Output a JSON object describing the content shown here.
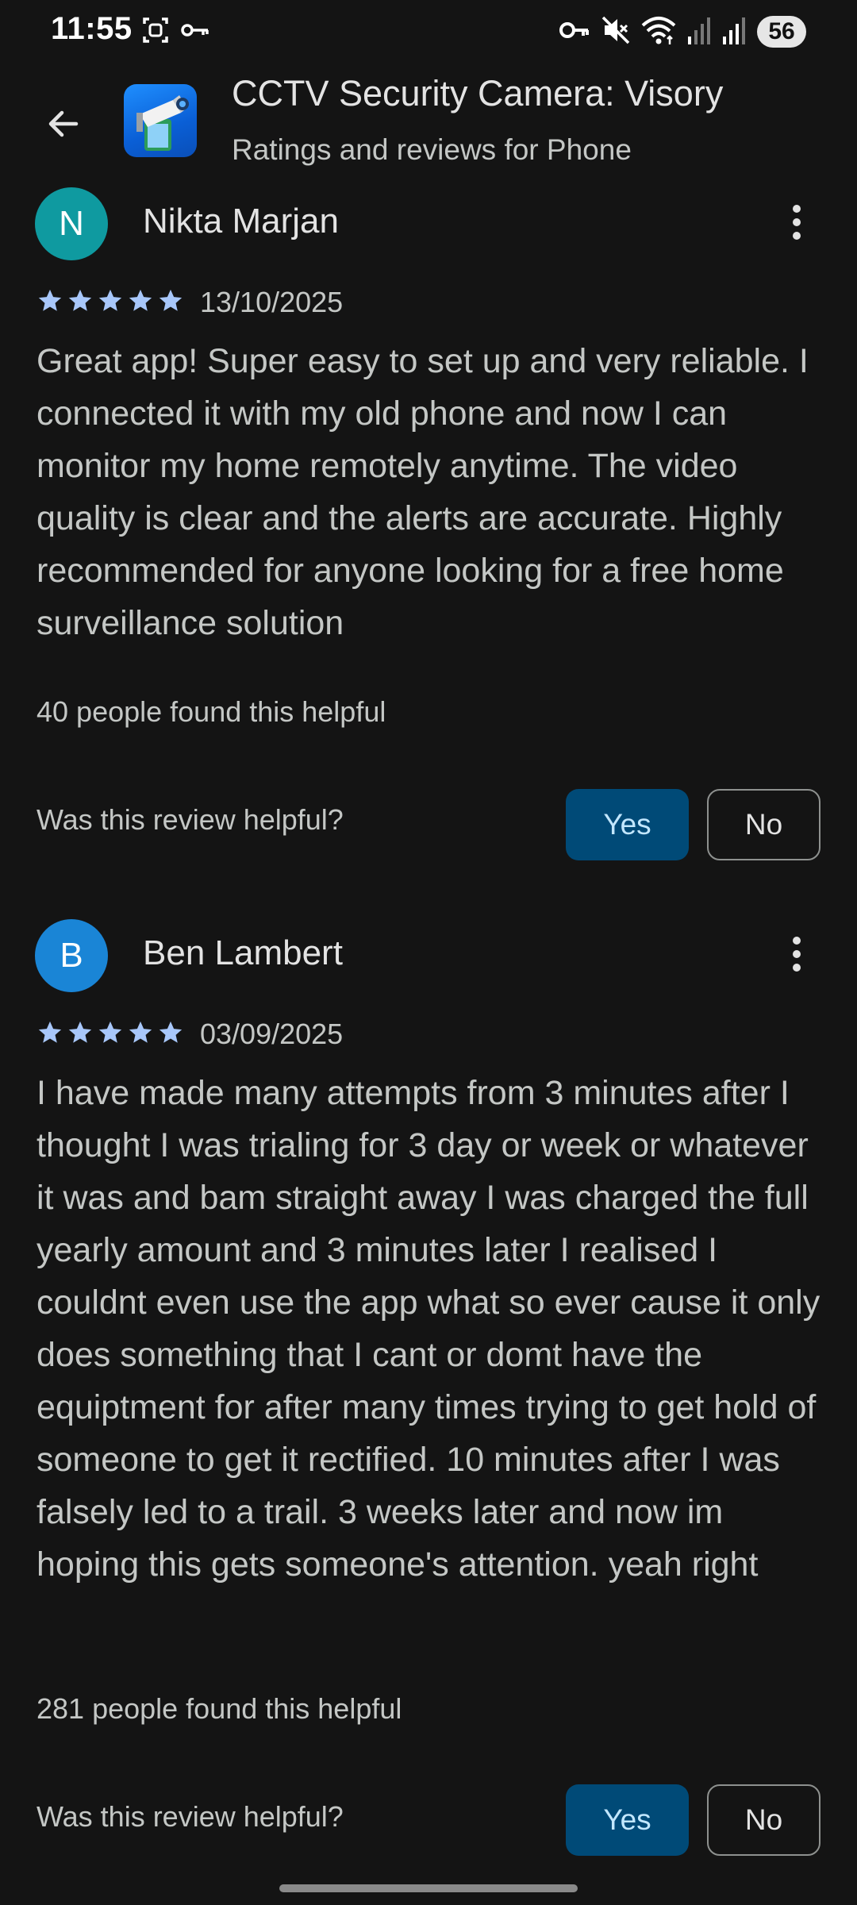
{
  "status_bar": {
    "time": "11:55",
    "battery": "56",
    "icons": [
      "screenshot-icon",
      "key-icon",
      "vpn-key-icon",
      "mute-icon",
      "wifi-icon",
      "signal-icon",
      "signal-icon"
    ]
  },
  "header": {
    "title": "CCTV Security Camera: Visory",
    "subtitle": "Ratings and reviews for Phone",
    "back_icon": "arrow-back-icon",
    "app_icon": "cctv-camera-app-icon"
  },
  "reviews": [
    {
      "avatar_letter": "N",
      "avatar_color": "#0f9aa0",
      "name": "Nikta Marjan",
      "stars": 5,
      "date": "13/10/2025",
      "text": "Great app! Super easy to set up and very reliable. I connected it with my old phone and now I can monitor my home remotely anytime. The video quality is clear and the alerts are accurate. Highly recommended for anyone looking for a free home surveillance solution",
      "helpful_count": "40 people found this helpful",
      "helpful_question": "Was this review helpful?",
      "yes_label": "Yes",
      "no_label": "No"
    },
    {
      "avatar_letter": "B",
      "avatar_color": "#1a85d6",
      "name": "Ben Lambert",
      "stars": 5,
      "date": "03/09/2025",
      "text": "I have made many attempts from 3 minutes after I thought I was trialing for 3 day or week or whatever it was and bam straight away I was charged the full yearly amount and 3 minutes later I realised I couldnt even use the app what so ever cause it only does something that I cant or domt have the equiptment for after many times trying to get hold of someone to get it rectified. 10 minutes after I was falsely led to a trail. 3 weeks later and now im hoping this gets someone's attention. yeah right",
      "helpful_count": "281 people found this helpful",
      "helpful_question": "Was this review helpful?",
      "yes_label": "Yes",
      "no_label": "No"
    }
  ],
  "colors": {
    "background": "#141414",
    "star": "#a8c7fa",
    "yes_button": "#004a77"
  }
}
